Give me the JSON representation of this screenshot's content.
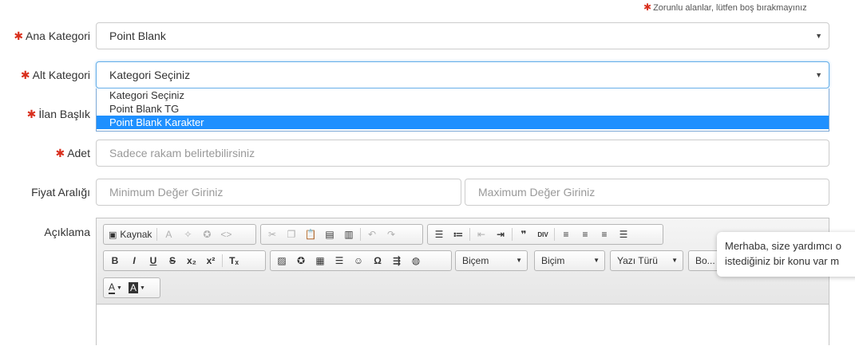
{
  "required_note": "Zorunlu alanlar, lütfen boş bırakmayınız",
  "fields": {
    "ana_kategori": {
      "label": "Ana Kategori",
      "value": "Point Blank"
    },
    "alt_kategori": {
      "label": "Alt Kategori",
      "value": "Kategori Seçiniz",
      "options": [
        "Kategori Seçiniz",
        "Point Blank TG",
        "Point Blank Karakter"
      ]
    },
    "ilan_baslik": {
      "label": "İlan Başlık"
    },
    "adet": {
      "label": "Adet",
      "placeholder": "Sadece rakam belirtebilirsiniz"
    },
    "fiyat_araligi": {
      "label": "Fiyat Aralığı",
      "min_placeholder": "Minimum Değer Giriniz",
      "max_placeholder": "Maximum Değer Giriniz"
    },
    "aciklama": {
      "label": "Açıklama"
    }
  },
  "editor": {
    "source_label": "Kaynak",
    "format_combo": "Biçem",
    "style_combo": "Biçim",
    "font_combo": "Yazı Türü",
    "size_combo": "Bo..."
  },
  "chat": {
    "line1": "Merhaba, size yardımcı o",
    "line2": "istediğiniz bir konu var m"
  }
}
